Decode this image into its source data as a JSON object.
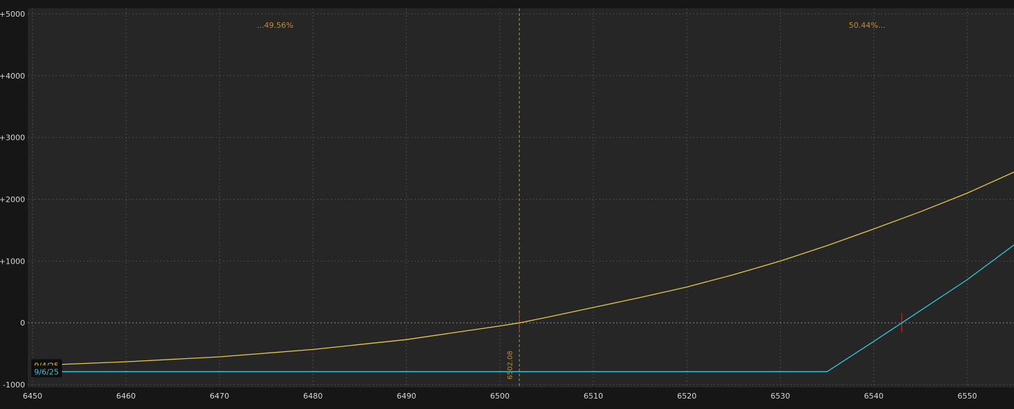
{
  "chart_data": {
    "type": "line",
    "title": "",
    "xlabel": "",
    "ylabel": "",
    "xlim": [
      6449.5,
      6555
    ],
    "ylim": [
      -1000,
      5000
    ],
    "x_ticks": [
      {
        "value": 6450,
        "label": "6450"
      },
      {
        "value": 6460,
        "label": "6460"
      },
      {
        "value": 6470,
        "label": "6470"
      },
      {
        "value": 6480,
        "label": "6480"
      },
      {
        "value": 6490,
        "label": "6490"
      },
      {
        "value": 6500,
        "label": "6500"
      },
      {
        "value": 6510,
        "label": "6510"
      },
      {
        "value": 6520,
        "label": "6520"
      },
      {
        "value": 6530,
        "label": "6530"
      },
      {
        "value": 6540,
        "label": "6540"
      },
      {
        "value": 6550,
        "label": "6550"
      }
    ],
    "y_ticks": [
      {
        "value": 5000,
        "label": "+5000"
      },
      {
        "value": 4000,
        "label": "+4000"
      },
      {
        "value": 3000,
        "label": "+3000"
      },
      {
        "value": 2000,
        "label": "+2000"
      },
      {
        "value": 1000,
        "label": "+1000"
      },
      {
        "value": 0,
        "label": "0"
      },
      {
        "value": -1000,
        "label": "-1000"
      }
    ],
    "grid": true,
    "series": [
      {
        "name": "9/4/25",
        "color": "#e8c84a",
        "x": [
          6450,
          6460,
          6470,
          6480,
          6490,
          6495,
          6500,
          6502.08,
          6505,
          6510,
          6515,
          6520,
          6525,
          6530,
          6535,
          6540,
          6545,
          6550,
          6555
        ],
        "y": [
          -690,
          -630,
          -550,
          -430,
          -270,
          -160,
          -50,
          0,
          90,
          250,
          410,
          580,
          780,
          1000,
          1250,
          1520,
          1800,
          2100,
          2440
        ]
      },
      {
        "name": "9/6/25",
        "color": "#35c8d8",
        "x": [
          6450,
          6460,
          6470,
          6480,
          6490,
          6500,
          6510,
          6520,
          6530,
          6535,
          6540,
          6543,
          6550,
          6555
        ],
        "y": [
          -790,
          -790,
          -790,
          -790,
          -790,
          -790,
          -790,
          -790,
          -790,
          -790,
          -300,
          0,
          700,
          1260
        ]
      }
    ],
    "annotations": {
      "vertical_marker": {
        "x": 6502.08,
        "label": "6502.08",
        "color": "#c88a2a"
      },
      "probability_left": {
        "label": "...49.56%",
        "color": "#c88a2a"
      },
      "probability_right": {
        "label": "50.44%...",
        "color": "#c88a2a"
      },
      "breakevens": [
        {
          "x": 6502.08,
          "y": 0
        },
        {
          "x": 6543,
          "y": 0
        }
      ]
    },
    "legend_placement": "bottom-left"
  },
  "colors": {
    "background": "#262626",
    "outer_background": "#161616",
    "grid": "#4a4a4a",
    "axis_text": "#d8d8d8",
    "breakeven_tick": "#e02828"
  }
}
